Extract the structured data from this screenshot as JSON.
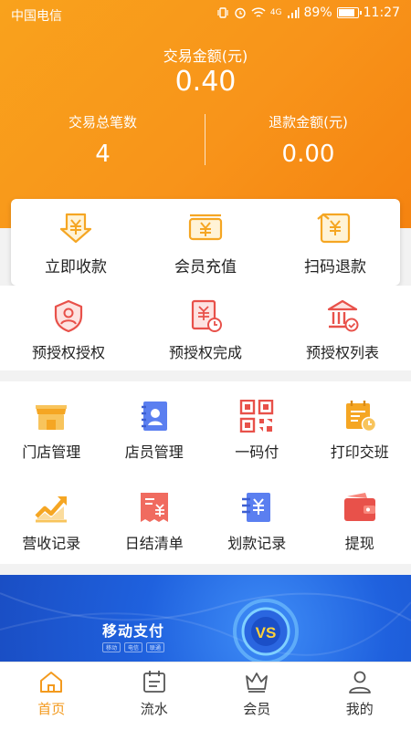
{
  "status_bar": {
    "carrier": "中国电信",
    "signal": "4G",
    "battery": "89%",
    "battery_level": 0.89,
    "time": "11:27"
  },
  "summary": {
    "amount_label": "交易金额(元)",
    "amount_value": "0.40",
    "count_label": "交易总笔数",
    "count_value": "4",
    "refund_label": "退款金额(元)",
    "refund_value": "0.00"
  },
  "quick_actions": [
    {
      "label": "立即收款",
      "icon": "download-yuan-icon"
    },
    {
      "label": "会员充值",
      "icon": "card-yuan-icon"
    },
    {
      "label": "扫码退款",
      "icon": "scan-refund-icon"
    }
  ],
  "preauth": [
    {
      "label": "预授权授权",
      "icon": "shield-user-icon"
    },
    {
      "label": "预授权完成",
      "icon": "receipt-clock-icon"
    },
    {
      "label": "预授权列表",
      "icon": "bank-icon"
    }
  ],
  "grid": [
    {
      "label": "门店管理",
      "icon": "store-icon"
    },
    {
      "label": "店员管理",
      "icon": "contacts-book-icon"
    },
    {
      "label": "一码付",
      "icon": "qr-code-icon"
    },
    {
      "label": "打印交班",
      "icon": "calendar-clock-icon"
    },
    {
      "label": "营收记录",
      "icon": "trend-chart-icon"
    },
    {
      "label": "日结清单",
      "icon": "bill-yuan-icon"
    },
    {
      "label": "划款记录",
      "icon": "transfer-yuan-icon"
    },
    {
      "label": "提现",
      "icon": "wallet-icon"
    }
  ],
  "banner": {
    "title": "移动支付",
    "tags": [
      "移动",
      "电信",
      "联通"
    ],
    "vs": "VS"
  },
  "tabs": [
    {
      "label": "首页",
      "icon": "home-icon",
      "active": true
    },
    {
      "label": "流水",
      "icon": "calendar-list-icon",
      "active": false
    },
    {
      "label": "会员",
      "icon": "crown-icon",
      "active": false
    },
    {
      "label": "我的",
      "icon": "person-icon",
      "active": false
    }
  ],
  "colors": {
    "header": "#f8941a",
    "accent_orange": "#f5a623",
    "accent_red": "#e8514a",
    "accent_blue": "#4d73e8",
    "tab_active": "#f39a1e"
  }
}
